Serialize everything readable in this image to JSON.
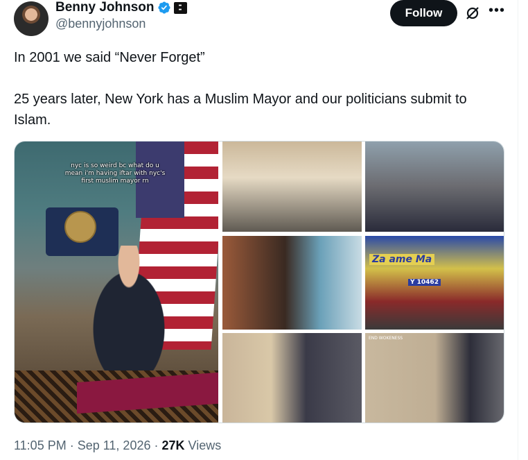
{
  "author": {
    "name": "Benny Johnson",
    "handle": "@bennyjohnson",
    "verified": true,
    "affiliate_badge_icon": "affiliate-badge-icon"
  },
  "actions": {
    "follow_label": "Follow",
    "grok_icon": "grok-icon",
    "more_icon": "more-icon",
    "more_glyph": "•••"
  },
  "tweet": {
    "line1": "In 2001 we said “Never Forget”",
    "line2": "25 years later, New York has a Muslim Mayor and our politicians submit to Islam."
  },
  "media": {
    "main_caption": "nyc is so weird bc what do u mean i'm having iftar with nyc's first muslim mayor rn",
    "tile5_caption": "END WOKENESS",
    "tile4_sign_text": "Za  ame Ma",
    "tile4_sign_text_2": "Y 10462"
  },
  "footer": {
    "time": "11:05 PM",
    "sep1": " · ",
    "date": "Sep 11, 2026",
    "sep2": " · ",
    "views_count": "27K",
    "views_label": " Views"
  },
  "colors": {
    "text": "#0f1419",
    "muted": "#536471",
    "verified_blue": "#1d9bf0",
    "follow_bg": "#0f1419"
  }
}
